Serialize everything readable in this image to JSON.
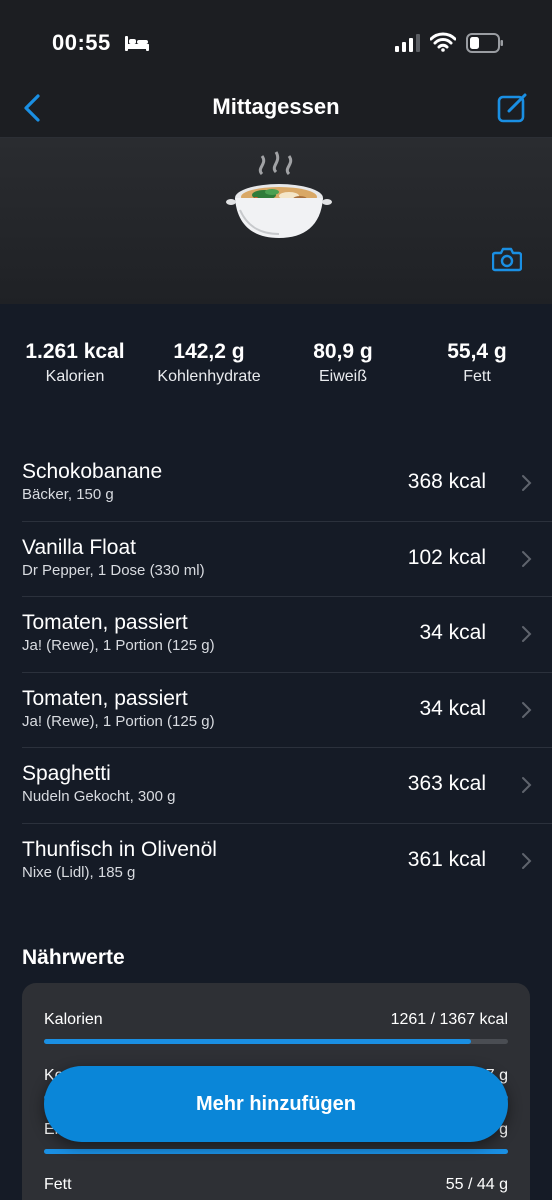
{
  "status_bar": {
    "time": "00:55"
  },
  "nav": {
    "title": "Mittagessen"
  },
  "summary": [
    {
      "value": "1.261 kcal",
      "label": "Kalorien"
    },
    {
      "value": "142,2 g",
      "label": "Kohlenhydrate"
    },
    {
      "value": "80,9 g",
      "label": "Eiweiß"
    },
    {
      "value": "55,4 g",
      "label": "Fett"
    }
  ],
  "foods": [
    {
      "name": "Schokobanane",
      "detail": "Bäcker, 150 g",
      "kcal": "368 kcal"
    },
    {
      "name": "Vanilla Float",
      "detail": "Dr Pepper, 1 Dose (330 ml)",
      "kcal": "102 kcal"
    },
    {
      "name": "Tomaten, passiert",
      "detail": "Ja! (Rewe), 1 Portion (125 g)",
      "kcal": "34 kcal"
    },
    {
      "name": "Tomaten, passiert",
      "detail": "Ja! (Rewe), 1 Portion (125 g)",
      "kcal": "34 kcal"
    },
    {
      "name": "Spaghetti",
      "detail": "Nudeln Gekocht, 300 g",
      "kcal": "363 kcal"
    },
    {
      "name": "Thunfisch in Olivenöl",
      "detail": "Nixe (Lidl), 185 g",
      "kcal": "361 kcal"
    }
  ],
  "nutrients": {
    "title": "Nährwerte",
    "rows": [
      {
        "label": "Kalorien",
        "value": "1261 / 1367 kcal",
        "progress": 0.92
      },
      {
        "label": "Ko",
        "value": "7 g",
        "progress": 1.0
      },
      {
        "label": "Ei",
        "value": "g",
        "progress": 1.0
      },
      {
        "label": "Fett",
        "value": "55 / 44 g",
        "progress": 1.0
      }
    ]
  },
  "add_button": {
    "label": "Mehr hinzufügen"
  },
  "colors": {
    "accent": "#1a8fe3",
    "button": "#0a86d8",
    "background": "#151b26"
  },
  "icons": {
    "back": "chevron-left-icon",
    "edit": "edit-icon",
    "camera": "camera-icon",
    "meal": "soup-bowl-icon",
    "row": "chevron-right-icon"
  }
}
